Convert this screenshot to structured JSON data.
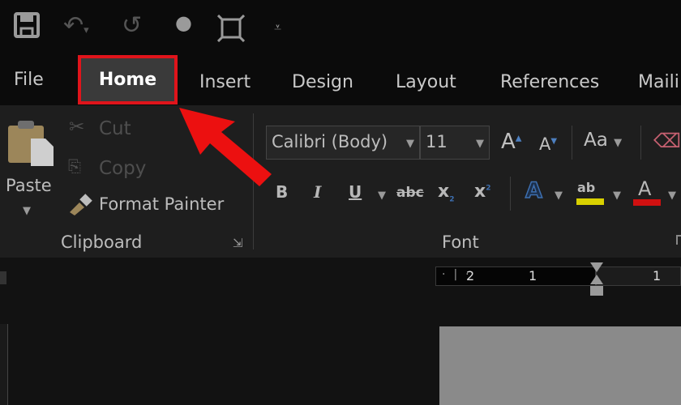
{
  "quick_access": {
    "icons": [
      "save-icon",
      "undo-icon",
      "redo-icon",
      "dot-icon",
      "fit-screen-icon",
      "customize-icon"
    ]
  },
  "tabs": [
    "File",
    "Home",
    "Insert",
    "Design",
    "Layout",
    "References",
    "Maili"
  ],
  "active_tab": "Home",
  "clipboard": {
    "paste": "Paste",
    "cut": "Cut",
    "copy": "Copy",
    "format_painter": "Format Painter",
    "group_label": "Clipboard"
  },
  "font": {
    "font_name": "Calibri (Body)",
    "font_size": "11",
    "grow": "A",
    "shrink": "A",
    "change_case": "Aa",
    "bold": "B",
    "italic": "I",
    "underline": "U",
    "strikethrough": "abc",
    "subscript": "x",
    "superscript": "x",
    "text_effects": "A",
    "highlight": "ab",
    "font_color": "A",
    "group_label": "Font"
  },
  "ruler": {
    "labels": [
      "2",
      "1",
      "1"
    ]
  },
  "colors": {
    "highlight_annotation": "#e0141b",
    "highlight_color": "#d8d000",
    "font_color": "#d01010"
  }
}
